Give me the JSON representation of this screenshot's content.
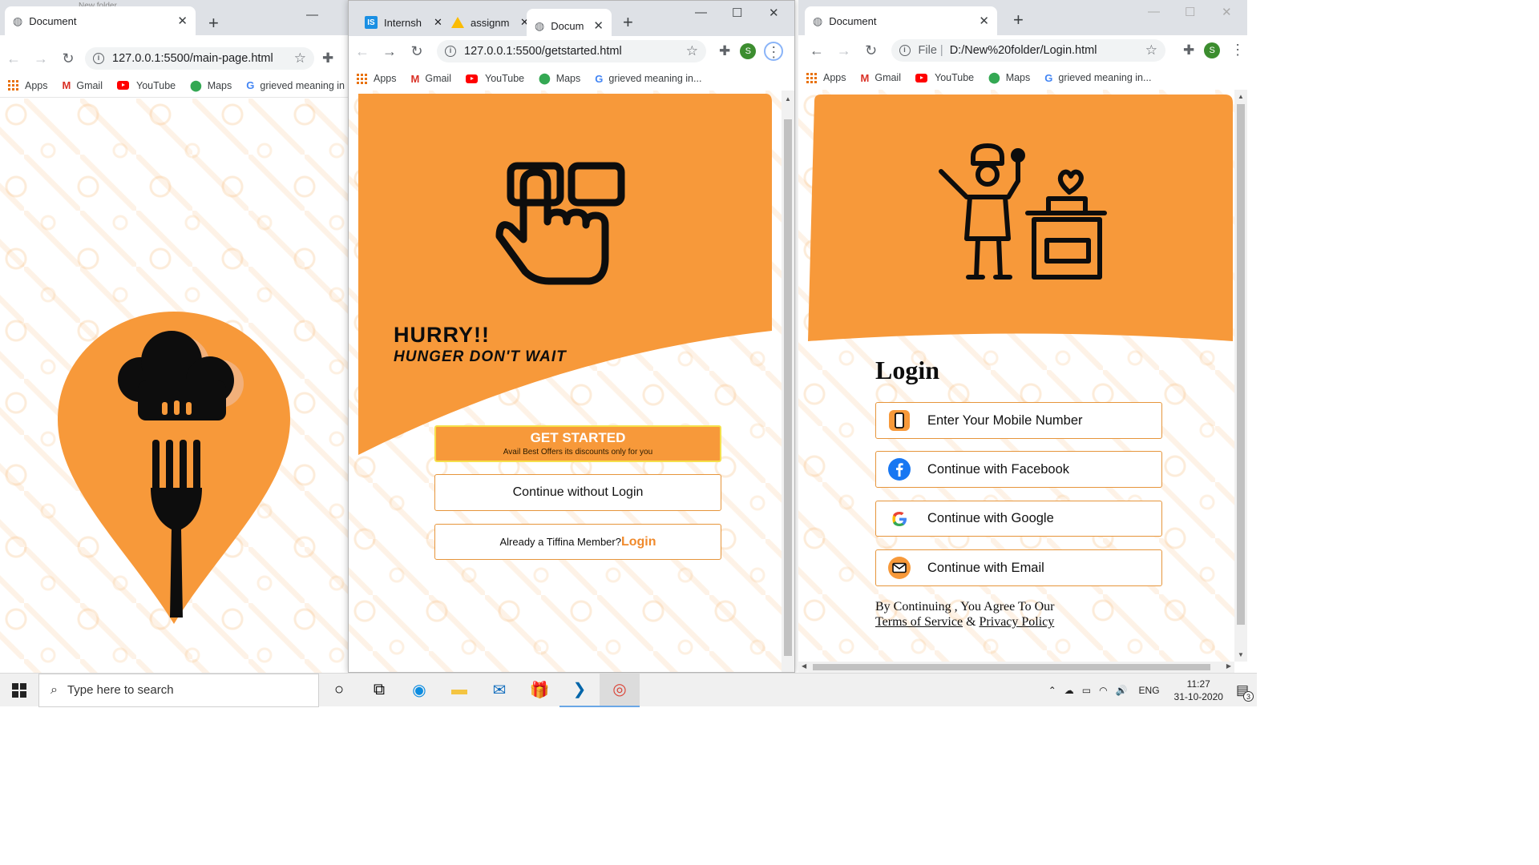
{
  "win1": {
    "tab_title": "Document",
    "url": "127.0.0.1:5500/main-page.html",
    "bookmarks": {
      "apps": "Apps",
      "gmail": "Gmail",
      "youtube": "YouTube",
      "maps": "Maps",
      "google": "grieved meaning in"
    },
    "folder_hint": "New folder"
  },
  "win2": {
    "tabs": [
      {
        "label": "Internsh"
      },
      {
        "label": "assignm"
      },
      {
        "label": "Docum"
      }
    ],
    "url": "127.0.0.1:5500/getstarted.html",
    "bookmarks": {
      "apps": "Apps",
      "gmail": "Gmail",
      "youtube": "YouTube",
      "maps": "Maps",
      "google": "grieved meaning in..."
    },
    "avatar": "S",
    "hero": {
      "headline": "HURRY!!",
      "subline": "HUNGER DON'T WAIT"
    },
    "get_started": {
      "label": "GET STARTED",
      "sub": "Avail Best Offers its discounts only for you"
    },
    "continue_without_login": "Continue without Login",
    "member_text": "Already a Tiffina Member?",
    "member_link": "Login"
  },
  "win3": {
    "tab_title": "Document",
    "url_prefix": "File",
    "url": "D:/New%20folder/Login.html",
    "bookmarks": {
      "apps": "Apps",
      "gmail": "Gmail",
      "youtube": "YouTube",
      "maps": "Maps",
      "google": "grieved meaning in..."
    },
    "avatar": "S",
    "login_title": "Login",
    "options": [
      {
        "icon": "phone-icon",
        "label": "Enter Your Mobile Number"
      },
      {
        "icon": "facebook-icon",
        "label": "Continue with Facebook"
      },
      {
        "icon": "google-icon",
        "label": "Continue with Google"
      },
      {
        "icon": "email-icon",
        "label": "Continue with Email"
      }
    ],
    "agree_text": "By Continuing , You Agree To Our",
    "terms": "Terms of Service",
    "amp": "&",
    "privacy": "Privacy Policy"
  },
  "taskbar": {
    "search_placeholder": "Type here to search",
    "lang": "ENG",
    "time": "11:27",
    "date": "31-10-2020",
    "notifications": "3"
  },
  "colors": {
    "brand_orange": "#f7993a",
    "dark": "#0d0d0d"
  }
}
